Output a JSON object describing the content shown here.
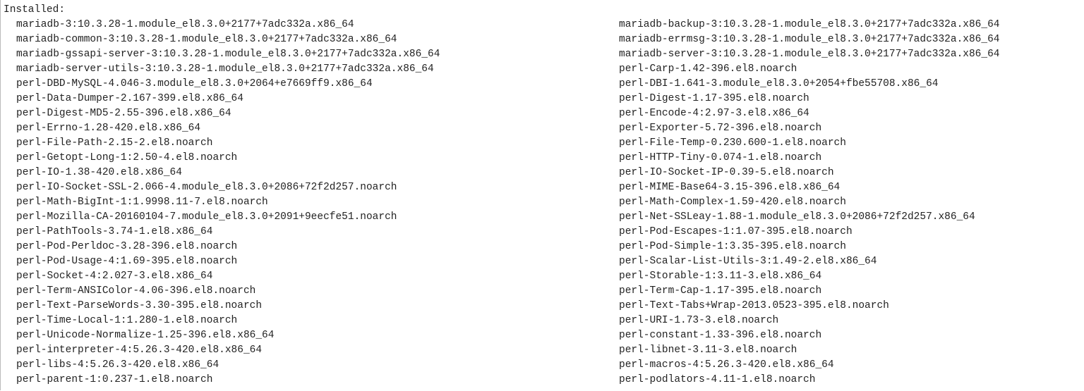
{
  "header": "Installed:",
  "left_packages": [
    "mariadb-3:10.3.28-1.module_el8.3.0+2177+7adc332a.x86_64",
    "mariadb-common-3:10.3.28-1.module_el8.3.0+2177+7adc332a.x86_64",
    "mariadb-gssapi-server-3:10.3.28-1.module_el8.3.0+2177+7adc332a.x86_64",
    "mariadb-server-utils-3:10.3.28-1.module_el8.3.0+2177+7adc332a.x86_64",
    "perl-DBD-MySQL-4.046-3.module_el8.3.0+2064+e7669ff9.x86_64",
    "perl-Data-Dumper-2.167-399.el8.x86_64",
    "perl-Digest-MD5-2.55-396.el8.x86_64",
    "perl-Errno-1.28-420.el8.x86_64",
    "perl-File-Path-2.15-2.el8.noarch",
    "perl-Getopt-Long-1:2.50-4.el8.noarch",
    "perl-IO-1.38-420.el8.x86_64",
    "perl-IO-Socket-SSL-2.066-4.module_el8.3.0+2086+72f2d257.noarch",
    "perl-Math-BigInt-1:1.9998.11-7.el8.noarch",
    "perl-Mozilla-CA-20160104-7.module_el8.3.0+2091+9eecfe51.noarch",
    "perl-PathTools-3.74-1.el8.x86_64",
    "perl-Pod-Perldoc-3.28-396.el8.noarch",
    "perl-Pod-Usage-4:1.69-395.el8.noarch",
    "perl-Socket-4:2.027-3.el8.x86_64",
    "perl-Term-ANSIColor-4.06-396.el8.noarch",
    "perl-Text-ParseWords-3.30-395.el8.noarch",
    "perl-Time-Local-1:1.280-1.el8.noarch",
    "perl-Unicode-Normalize-1.25-396.el8.x86_64",
    "perl-interpreter-4:5.26.3-420.el8.x86_64",
    "perl-libs-4:5.26.3-420.el8.x86_64",
    "perl-parent-1:0.237-1.el8.noarch"
  ],
  "right_packages": [
    "mariadb-backup-3:10.3.28-1.module_el8.3.0+2177+7adc332a.x86_64",
    "mariadb-errmsg-3:10.3.28-1.module_el8.3.0+2177+7adc332a.x86_64",
    "mariadb-server-3:10.3.28-1.module_el8.3.0+2177+7adc332a.x86_64",
    "perl-Carp-1.42-396.el8.noarch",
    "perl-DBI-1.641-3.module_el8.3.0+2054+fbe55708.x86_64",
    "perl-Digest-1.17-395.el8.noarch",
    "perl-Encode-4:2.97-3.el8.x86_64",
    "perl-Exporter-5.72-396.el8.noarch",
    "perl-File-Temp-0.230.600-1.el8.noarch",
    "perl-HTTP-Tiny-0.074-1.el8.noarch",
    "perl-IO-Socket-IP-0.39-5.el8.noarch",
    "perl-MIME-Base64-3.15-396.el8.x86_64",
    "perl-Math-Complex-1.59-420.el8.noarch",
    "perl-Net-SSLeay-1.88-1.module_el8.3.0+2086+72f2d257.x86_64",
    "perl-Pod-Escapes-1:1.07-395.el8.noarch",
    "perl-Pod-Simple-1:3.35-395.el8.noarch",
    "perl-Scalar-List-Utils-3:1.49-2.el8.x86_64",
    "perl-Storable-1:3.11-3.el8.x86_64",
    "perl-Term-Cap-1.17-395.el8.noarch",
    "perl-Text-Tabs+Wrap-2013.0523-395.el8.noarch",
    "perl-URI-1.73-3.el8.noarch",
    "perl-constant-1.33-396.el8.noarch",
    "perl-libnet-3.11-3.el8.noarch",
    "perl-macros-4:5.26.3-420.el8.x86_64",
    "perl-podlators-4.11-1.el8.noarch"
  ]
}
